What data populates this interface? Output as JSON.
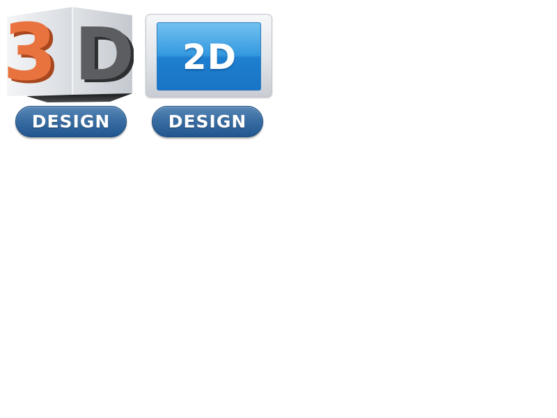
{
  "logos": {
    "three_d": {
      "numeral": "3",
      "letter": "D",
      "badge": "DESIGN",
      "numeral_color": "#e8733f",
      "letter_color": "#5b5d61"
    },
    "two_d": {
      "title": "2D",
      "badge": "DESIGN",
      "panel_color": "#2f8fdc"
    }
  },
  "colors": {
    "badge_blue": "#3a6ea3",
    "background": "#ffffff"
  }
}
